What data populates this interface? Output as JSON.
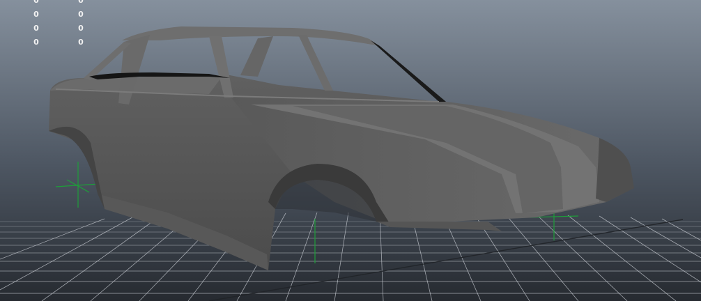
{
  "hud": {
    "rows": [
      {
        "left": "0",
        "right": "0"
      },
      {
        "left": "0",
        "right": "0"
      },
      {
        "left": "0",
        "right": "0"
      },
      {
        "left": "0",
        "right": "0"
      }
    ]
  },
  "colors": {
    "bg_top": "#85909d",
    "bg_bottom": "#262a30",
    "grid": "#c9ced4",
    "model_light": "#6d6d6d",
    "model_mid": "#5a5a5a",
    "model_dark": "#3e3e3e",
    "axis_green": "#1e9e3a"
  }
}
